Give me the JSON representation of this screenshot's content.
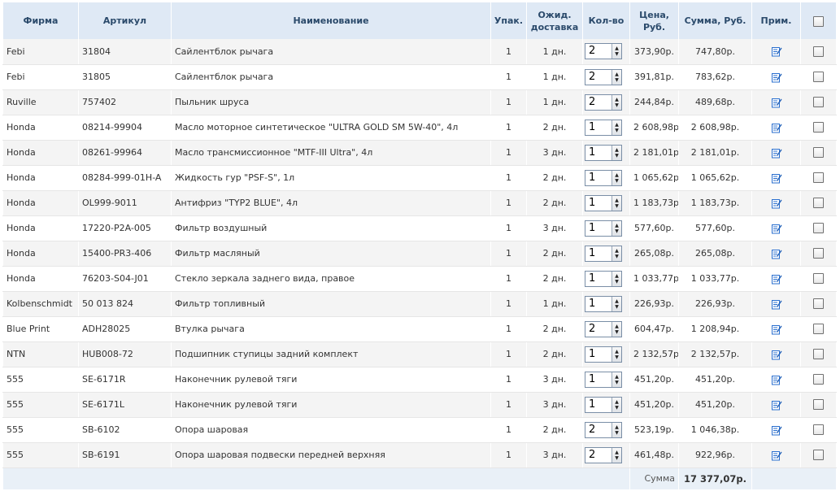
{
  "headers": {
    "firm": "Фирма",
    "article": "Артикул",
    "name": "Наименование",
    "pack": "Упак.",
    "delivery_line1": "Ожид.",
    "delivery_line2": "доставка",
    "qty": "Кол-во",
    "price_line1": "Цена,",
    "price_line2": "Руб.",
    "sum": "Сумма, Руб.",
    "note": "Прим."
  },
  "rows": [
    {
      "firm": "Febi",
      "article": "31804",
      "name": "Сайлентблок рычага",
      "pack": "1",
      "delivery": "1 дн.",
      "qty": "2",
      "price": "373,90р.",
      "sum": "747,80р."
    },
    {
      "firm": "Febi",
      "article": "31805",
      "name": "Сайлентблок рычага",
      "pack": "1",
      "delivery": "1 дн.",
      "qty": "2",
      "price": "391,81р.",
      "sum": "783,62р."
    },
    {
      "firm": "Ruville",
      "article": "757402",
      "name": "Пыльник шруса",
      "pack": "1",
      "delivery": "1 дн.",
      "qty": "2",
      "price": "244,84р.",
      "sum": "489,68р."
    },
    {
      "firm": "Honda",
      "article": "08214-99904",
      "name": "Масло моторное синтетическое \"ULTRA GOLD SM 5W-40\", 4л",
      "pack": "1",
      "delivery": "2 дн.",
      "qty": "1",
      "price": "2 608,98р.",
      "sum": "2 608,98р."
    },
    {
      "firm": "Honda",
      "article": "08261-99964",
      "name": "Масло трансмиссионное \"MTF-III Ultra\", 4л",
      "pack": "1",
      "delivery": "3 дн.",
      "qty": "1",
      "price": "2 181,01р.",
      "sum": "2 181,01р."
    },
    {
      "firm": "Honda",
      "article": "08284-999-01H-A",
      "name": "Жидкость гур \"PSF-S\", 1л",
      "pack": "1",
      "delivery": "2 дн.",
      "qty": "1",
      "price": "1 065,62р.",
      "sum": "1 065,62р."
    },
    {
      "firm": "Honda",
      "article": "OL999-9011",
      "name": "Антифриз \"TYP2 BLUE\", 4л",
      "pack": "1",
      "delivery": "2 дн.",
      "qty": "1",
      "price": "1 183,73р.",
      "sum": "1 183,73р."
    },
    {
      "firm": "Honda",
      "article": "17220-P2A-005",
      "name": "Фильтр воздушный",
      "pack": "1",
      "delivery": "3 дн.",
      "qty": "1",
      "price": "577,60р.",
      "sum": "577,60р."
    },
    {
      "firm": "Honda",
      "article": "15400-PR3-406",
      "name": "Фильтр масляный",
      "pack": "1",
      "delivery": "2 дн.",
      "qty": "1",
      "price": "265,08р.",
      "sum": "265,08р."
    },
    {
      "firm": "Honda",
      "article": "76203-S04-J01",
      "name": "Стекло зеркала заднего вида, правое",
      "pack": "1",
      "delivery": "2 дн.",
      "qty": "1",
      "price": "1 033,77р.",
      "sum": "1 033,77р."
    },
    {
      "firm": "Kolbenschmidt",
      "article": "50 013 824",
      "name": "Фильтр топливный",
      "pack": "1",
      "delivery": "1 дн.",
      "qty": "1",
      "price": "226,93р.",
      "sum": "226,93р."
    },
    {
      "firm": "Blue Print",
      "article": "ADH28025",
      "name": "Втулка рычага",
      "pack": "1",
      "delivery": "2 дн.",
      "qty": "2",
      "price": "604,47р.",
      "sum": "1 208,94р."
    },
    {
      "firm": "NTN",
      "article": "HUB008-72",
      "name": "Подшипник ступицы задний комплект",
      "pack": "1",
      "delivery": "2 дн.",
      "qty": "1",
      "price": "2 132,57р.",
      "sum": "2 132,57р."
    },
    {
      "firm": "555",
      "article": "SE-6171R",
      "name": "Наконечник рулевой тяги",
      "pack": "1",
      "delivery": "3 дн.",
      "qty": "1",
      "price": "451,20р.",
      "sum": "451,20р."
    },
    {
      "firm": "555",
      "article": "SE-6171L",
      "name": "Наконечник рулевой тяги",
      "pack": "1",
      "delivery": "3 дн.",
      "qty": "1",
      "price": "451,20р.",
      "sum": "451,20р."
    },
    {
      "firm": "555",
      "article": "SB-6102",
      "name": "Опора шаровая",
      "pack": "1",
      "delivery": "2 дн.",
      "qty": "2",
      "price": "523,19р.",
      "sum": "1 046,38р."
    },
    {
      "firm": "555",
      "article": "SB-6191",
      "name": "Опора шаровая подвески передней верхняя",
      "pack": "1",
      "delivery": "3 дн.",
      "qty": "2",
      "price": "461,48р.",
      "sum": "922,96р."
    }
  ],
  "footer": {
    "sum_label": "Сумма",
    "total": "17 377,07р."
  },
  "colors": {
    "header_bg": "#dfe9f5",
    "header_text": "#2b4a6b",
    "row_alt_bg": "#f4f4f4",
    "icon_blue": "#2a6fcf"
  },
  "icons": {
    "note": "edit-note-icon",
    "spinner": "spinner-arrows-icon"
  }
}
